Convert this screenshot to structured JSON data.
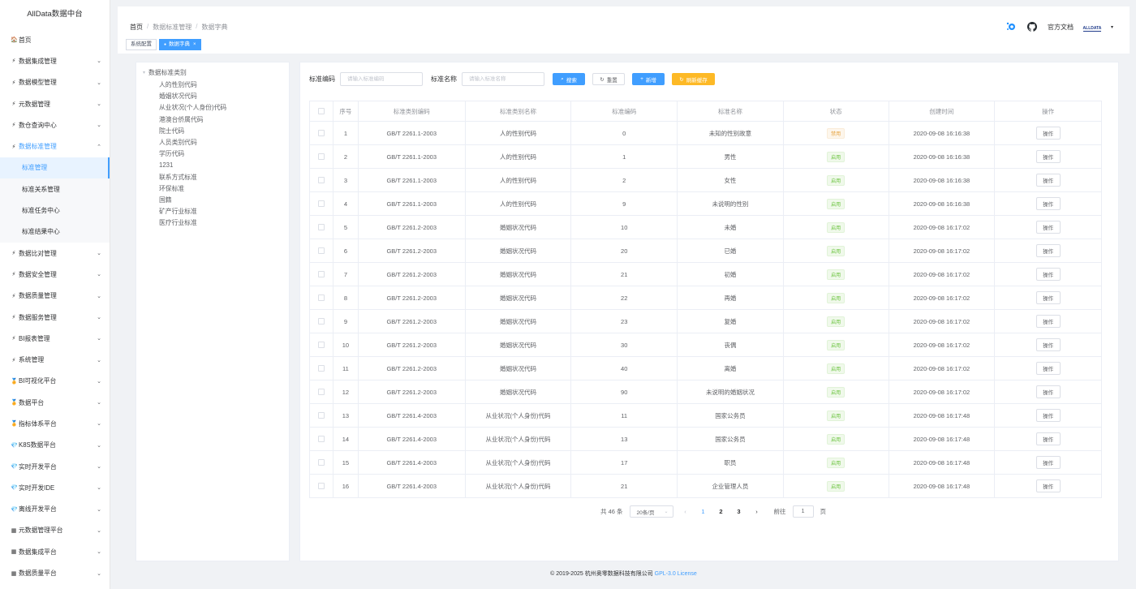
{
  "brand": "AllData数据中台",
  "sidebar": {
    "items": [
      {
        "icon": "🏠",
        "label": "首页",
        "chevron": "",
        "cls": ""
      },
      {
        "icon": "⚡",
        "label": "数据集成管理",
        "chevron": "⌄",
        "cls": ""
      },
      {
        "icon": "⚡",
        "label": "数据模型管理",
        "chevron": "⌄",
        "cls": ""
      },
      {
        "icon": "⚡",
        "label": "元数据管理",
        "chevron": "⌄",
        "cls": ""
      },
      {
        "icon": "⚡",
        "label": "数仓查询中心",
        "chevron": "⌄",
        "cls": ""
      },
      {
        "icon": "⚡",
        "label": "数据标准管理",
        "chevron": "⌃",
        "cls": "open"
      },
      {
        "icon": "",
        "label": "标准管理",
        "chevron": "",
        "cls": "sub active"
      },
      {
        "icon": "",
        "label": "标准关系管理",
        "chevron": "",
        "cls": "sub"
      },
      {
        "icon": "",
        "label": "标准任务中心",
        "chevron": "",
        "cls": "sub"
      },
      {
        "icon": "",
        "label": "标准结果中心",
        "chevron": "",
        "cls": "sub"
      },
      {
        "icon": "⚡",
        "label": "数据比对管理",
        "chevron": "⌄",
        "cls": ""
      },
      {
        "icon": "⚡",
        "label": "数据安全管理",
        "chevron": "⌄",
        "cls": ""
      },
      {
        "icon": "⚡",
        "label": "数据质量管理",
        "chevron": "⌄",
        "cls": ""
      },
      {
        "icon": "⚡",
        "label": "数据服务管理",
        "chevron": "⌄",
        "cls": ""
      },
      {
        "icon": "⚡",
        "label": "BI报表管理",
        "chevron": "⌄",
        "cls": ""
      },
      {
        "icon": "⚡",
        "label": "系统管理",
        "chevron": "⌄",
        "cls": ""
      },
      {
        "icon": "🏅",
        "label": "BI可视化平台",
        "chevron": "⌄",
        "cls": ""
      },
      {
        "icon": "🏅",
        "label": "数据平台",
        "chevron": "⌄",
        "cls": ""
      },
      {
        "icon": "🏅",
        "label": "指标体系平台",
        "chevron": "⌄",
        "cls": ""
      },
      {
        "icon": "💎",
        "label": "K8S数据平台",
        "chevron": "⌄",
        "cls": ""
      },
      {
        "icon": "💎",
        "label": "实时开发平台",
        "chevron": "⌄",
        "cls": ""
      },
      {
        "icon": "💎",
        "label": "实时开发IDE",
        "chevron": "⌄",
        "cls": ""
      },
      {
        "icon": "💎",
        "label": "离线开发平台",
        "chevron": "⌄",
        "cls": ""
      },
      {
        "icon": "▦",
        "label": "元数据管理平台",
        "chevron": "⌄",
        "cls": ""
      },
      {
        "icon": "▦",
        "label": "数据集成平台",
        "chevron": "⌄",
        "cls": ""
      },
      {
        "icon": "▦",
        "label": "数据质量平台",
        "chevron": "⌄",
        "cls": ""
      }
    ]
  },
  "header": {
    "breadcrumb": [
      "首页",
      "数据标准管理",
      "数据字典"
    ],
    "docs_label": "官方文档",
    "avatar_text": "ALLDATA",
    "tags": [
      {
        "label": "系统配置",
        "active": false
      },
      {
        "label": "数据字典",
        "active": true
      }
    ]
  },
  "tree": {
    "root": "数据标准类别",
    "children": [
      "人的性别代码",
      "婚姻状况代码",
      "从业状况(个人身份)代码",
      "港澳台侨属代码",
      "院士代码",
      "人员类别代码",
      "学历代码",
      "1231",
      "联系方式标准",
      "环保标准",
      "国籍",
      "矿产行业标准",
      "医疗行业标准"
    ]
  },
  "search": {
    "code_label": "标准编码",
    "code_placeholder": "请输入标准编码",
    "name_label": "标准名称",
    "name_placeholder": "请输入标准名称",
    "search_btn": "搜索",
    "reset_btn": "重置",
    "add_btn": "新增",
    "refresh_btn": "刷新缓存"
  },
  "table": {
    "headers": [
      "序号",
      "标准类别编码",
      "标准类别名称",
      "标准编码",
      "标准名称",
      "状态",
      "创建时间",
      "操作"
    ],
    "op_label": "操作",
    "rows": [
      {
        "idx": "1",
        "code": "GB/T 2261.1-2003",
        "name": "人的性别代码",
        "scode": "0",
        "sname": "未知的性别故意",
        "status": "禁用",
        "active": false,
        "time": "2020-09-08 16:16:38"
      },
      {
        "idx": "2",
        "code": "GB/T 2261.1-2003",
        "name": "人的性别代码",
        "scode": "1",
        "sname": "男性",
        "status": "启用",
        "active": true,
        "time": "2020-09-08 16:16:38"
      },
      {
        "idx": "3",
        "code": "GB/T 2261.1-2003",
        "name": "人的性别代码",
        "scode": "2",
        "sname": "女性",
        "status": "启用",
        "active": true,
        "time": "2020-09-08 16:16:38"
      },
      {
        "idx": "4",
        "code": "GB/T 2261.1-2003",
        "name": "人的性别代码",
        "scode": "9",
        "sname": "未说明的性别",
        "status": "启用",
        "active": true,
        "time": "2020-09-08 16:16:38"
      },
      {
        "idx": "5",
        "code": "GB/T 2261.2-2003",
        "name": "婚姻状况代码",
        "scode": "10",
        "sname": "未婚",
        "status": "启用",
        "active": true,
        "time": "2020-09-08 16:17:02"
      },
      {
        "idx": "6",
        "code": "GB/T 2261.2-2003",
        "name": "婚姻状况代码",
        "scode": "20",
        "sname": "已婚",
        "status": "启用",
        "active": true,
        "time": "2020-09-08 16:17:02"
      },
      {
        "idx": "7",
        "code": "GB/T 2261.2-2003",
        "name": "婚姻状况代码",
        "scode": "21",
        "sname": "初婚",
        "status": "启用",
        "active": true,
        "time": "2020-09-08 16:17:02"
      },
      {
        "idx": "8",
        "code": "GB/T 2261.2-2003",
        "name": "婚姻状况代码",
        "scode": "22",
        "sname": "再婚",
        "status": "启用",
        "active": true,
        "time": "2020-09-08 16:17:02"
      },
      {
        "idx": "9",
        "code": "GB/T 2261.2-2003",
        "name": "婚姻状况代码",
        "scode": "23",
        "sname": "复婚",
        "status": "启用",
        "active": true,
        "time": "2020-09-08 16:17:02"
      },
      {
        "idx": "10",
        "code": "GB/T 2261.2-2003",
        "name": "婚姻状况代码",
        "scode": "30",
        "sname": "丧偶",
        "status": "启用",
        "active": true,
        "time": "2020-09-08 16:17:02"
      },
      {
        "idx": "11",
        "code": "GB/T 2261.2-2003",
        "name": "婚姻状况代码",
        "scode": "40",
        "sname": "离婚",
        "status": "启用",
        "active": true,
        "time": "2020-09-08 16:17:02"
      },
      {
        "idx": "12",
        "code": "GB/T 2261.2-2003",
        "name": "婚姻状况代码",
        "scode": "90",
        "sname": "未说明的婚姻状况",
        "status": "启用",
        "active": true,
        "time": "2020-09-08 16:17:02"
      },
      {
        "idx": "13",
        "code": "GB/T 2261.4-2003",
        "name": "从业状况(个人身份)代码",
        "scode": "11",
        "sname": "国家公务员",
        "status": "启用",
        "active": true,
        "time": "2020-09-08 16:17:48"
      },
      {
        "idx": "14",
        "code": "GB/T 2261.4-2003",
        "name": "从业状况(个人身份)代码",
        "scode": "13",
        "sname": "国家公务员",
        "status": "启用",
        "active": true,
        "time": "2020-09-08 16:17:48"
      },
      {
        "idx": "15",
        "code": "GB/T 2261.4-2003",
        "name": "从业状况(个人身份)代码",
        "scode": "17",
        "sname": "职员",
        "status": "启用",
        "active": true,
        "time": "2020-09-08 16:17:48"
      },
      {
        "idx": "16",
        "code": "GB/T 2261.4-2003",
        "name": "从业状况(个人身份)代码",
        "scode": "21",
        "sname": "企业管理人员",
        "status": "启用",
        "active": true,
        "time": "2020-09-08 16:17:48"
      }
    ]
  },
  "pagination": {
    "total": "共 46 条",
    "page_size": "20条/页",
    "pages": [
      "1",
      "2",
      "3"
    ],
    "current": "1",
    "jump_prefix": "前往",
    "jump_value": "1",
    "jump_suffix": "页"
  },
  "footer": {
    "copyright": "© 2019-2025 杭州奥零数据科技有限公司",
    "license": "GPL-3.0 License"
  },
  "colors": {
    "primary": "#409eff",
    "warning": "#fdb926",
    "success": "#67c23a"
  }
}
